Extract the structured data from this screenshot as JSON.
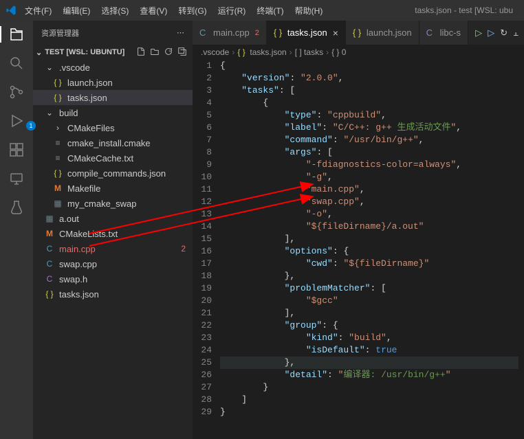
{
  "titlebar": {
    "menus": [
      "文件(F)",
      "编辑(E)",
      "选择(S)",
      "查看(V)",
      "转到(G)",
      "运行(R)",
      "终端(T)",
      "帮助(H)"
    ],
    "title": "tasks.json - test [WSL: ubu"
  },
  "activity": {
    "debug_badge": "1"
  },
  "sidebar": {
    "title": "资源管理器",
    "section": "TEST [WSL: UBUNTU]",
    "tree": [
      {
        "kind": "folder",
        "name": ".vscode",
        "indent": 0,
        "open": true
      },
      {
        "kind": "json",
        "name": "launch.json",
        "indent": 1
      },
      {
        "kind": "json",
        "name": "tasks.json",
        "indent": 1,
        "selected": true
      },
      {
        "kind": "folder",
        "name": "build",
        "indent": 0,
        "open": true
      },
      {
        "kind": "folder",
        "name": "CMakeFiles",
        "indent": 1,
        "open": false
      },
      {
        "kind": "cmake",
        "name": "cmake_install.cmake",
        "indent": 1
      },
      {
        "kind": "txt",
        "name": "CMakeCache.txt",
        "indent": 1
      },
      {
        "kind": "json",
        "name": "compile_commands.json",
        "indent": 1
      },
      {
        "kind": "make",
        "name": "Makefile",
        "indent": 1
      },
      {
        "kind": "bin",
        "name": "my_cmake_swap",
        "indent": 1
      },
      {
        "kind": "bin",
        "name": "a.out",
        "indent": 0
      },
      {
        "kind": "make",
        "name": "CMakeLists.txt",
        "indent": 0
      },
      {
        "kind": "cpp",
        "name": "main.cpp",
        "indent": 0,
        "err": "2"
      },
      {
        "kind": "cpp",
        "name": "swap.cpp",
        "indent": 0
      },
      {
        "kind": "h",
        "name": "swap.h",
        "indent": 0
      },
      {
        "kind": "json",
        "name": "tasks.json",
        "indent": 0
      }
    ]
  },
  "tabs": {
    "items": [
      {
        "icon": "cpp",
        "label": "main.cpp",
        "dirty": "2",
        "active": false
      },
      {
        "icon": "json",
        "label": "tasks.json",
        "active": true,
        "close": true
      },
      {
        "icon": "json",
        "label": "launch.json",
        "active": false
      },
      {
        "icon": "h",
        "label": "libc-s",
        "active": false
      }
    ]
  },
  "breadcrumb": {
    "parts": [
      ".vscode",
      "tasks.json",
      "tasks",
      "0"
    ],
    "sym_tasks": "[ ] tasks",
    "sym_zero": "{ } 0"
  },
  "code": {
    "lines": [
      "{",
      "    \"version\": \"2.0.0\",",
      "    \"tasks\": [",
      "        {",
      "            \"type\": \"cppbuild\",",
      "            \"label\": \"C/C++: g++ 生成活动文件\",",
      "            \"command\": \"/usr/bin/g++\",",
      "            \"args\": [",
      "                \"-fdiagnostics-color=always\",",
      "                \"-g\",",
      "                \"main.cpp\",",
      "                \"swap.cpp\",",
      "                \"-o\",",
      "                \"${fileDirname}/a.out\"",
      "            ],",
      "            \"options\": {",
      "                \"cwd\": \"${fileDirname}\"",
      "            },",
      "            \"problemMatcher\": [",
      "                \"$gcc\"",
      "            ],",
      "            \"group\": {",
      "                \"kind\": \"build\",",
      "                \"isDefault\": true",
      "            },",
      "            \"detail\": \"编译器: /usr/bin/g++\"",
      "        }",
      "    ]",
      "}"
    ],
    "highlight_line": 25
  },
  "chart_data": {
    "type": "table",
    "title": "tasks.json",
    "data": {
      "version": "2.0.0",
      "tasks": [
        {
          "type": "cppbuild",
          "label": "C/C++: g++ 生成活动文件",
          "command": "/usr/bin/g++",
          "args": [
            "-fdiagnostics-color=always",
            "-g",
            "main.cpp",
            "swap.cpp",
            "-o",
            "${fileDirname}/a.out"
          ],
          "options": {
            "cwd": "${fileDirname}"
          },
          "problemMatcher": [
            "$gcc"
          ],
          "group": {
            "kind": "build",
            "isDefault": true
          },
          "detail": "编译器: /usr/bin/g++"
        }
      ]
    }
  }
}
